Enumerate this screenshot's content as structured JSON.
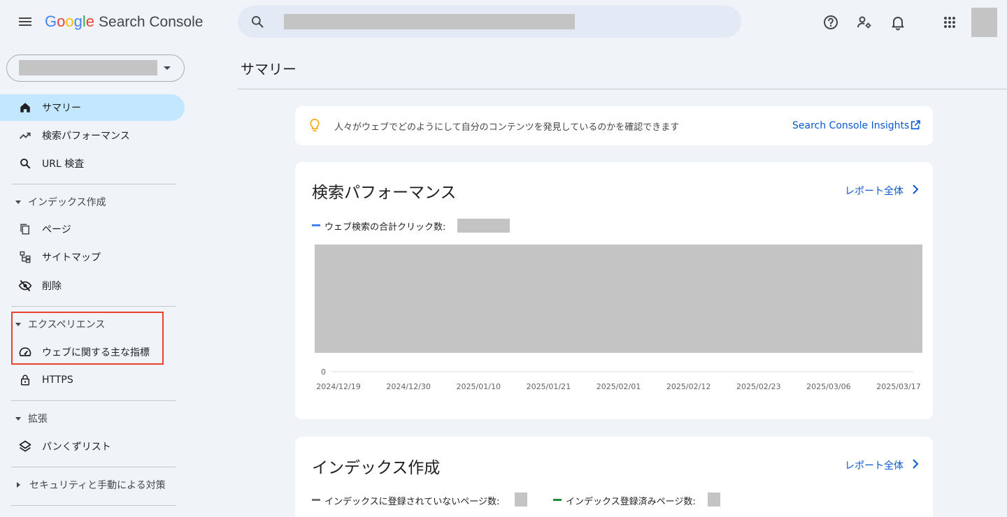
{
  "header": {
    "logo": {
      "g1": "G",
      "g2": "o",
      "g3": "o",
      "g4": "g",
      "g5": "l",
      "g6": "e",
      "product": "Search Console"
    },
    "icons": [
      "menu-icon",
      "search-icon",
      "help-icon",
      "manage-users-icon",
      "notifications-icon",
      "apps-icon"
    ]
  },
  "sidebar": {
    "items": {
      "summary": "サマリー",
      "performance": "検索パフォーマンス",
      "url_inspection": "URL 検査",
      "pages": "ページ",
      "sitemaps": "サイトマップ",
      "removals": "削除",
      "cwv": "ウェブに関する主な指標",
      "https": "HTTPS",
      "breadcrumbs": "パンくずリスト"
    },
    "sections": {
      "indexing": "インデックス作成",
      "experience": "エクスペリエンス",
      "enhancements": "拡張",
      "security": "セキュリティと手動による対策"
    }
  },
  "main": {
    "page_title": "サマリー",
    "insight": {
      "text": "人々がウェブでどのようにして自分のコンテンツを発見しているのかを確認できます",
      "link": "Search Console Insights"
    },
    "performance": {
      "title": "検索パフォーマンス",
      "report_link": "レポート全体",
      "legend": "ウェブ検索の合計クリック数:"
    },
    "indexing": {
      "title": "インデックス作成",
      "report_link": "レポート全体",
      "legend_not_indexed": "インデックスに登録されていないページ数:",
      "legend_indexed": "インデックス登録済みページ数:"
    }
  },
  "chart_data": {
    "type": "line",
    "x_ticks": [
      "2024/12/19",
      "2024/12/30",
      "2025/01/10",
      "2025/01/21",
      "2025/02/01",
      "2025/02/12",
      "2025/02/23",
      "2025/03/06",
      "2025/03/17"
    ],
    "y_ticks": [
      "0"
    ],
    "series": [],
    "colors": {
      "clicks": "#4285f4",
      "not_indexed": "#757575",
      "indexed": "#1e8e3e"
    }
  }
}
